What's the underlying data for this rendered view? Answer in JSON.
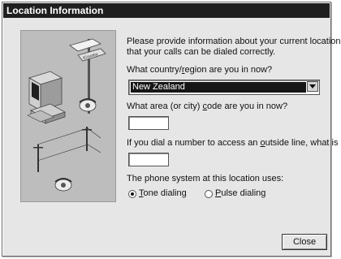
{
  "window": {
    "title": "Location Information"
  },
  "illustration": {
    "signpost_text": "ICountry"
  },
  "intro": {
    "line1": "Please provide information about your current location so",
    "line2": "that your calls can be dialed correctly."
  },
  "country": {
    "label_pre": "What country/",
    "label_u": "r",
    "label_post": "egion are you in now?",
    "value": "New Zealand"
  },
  "area": {
    "label_pre": "What area (or city) ",
    "label_u": "c",
    "label_post": "ode are you in now?",
    "value": ""
  },
  "outside": {
    "label_pre": "If you dial a number to access an ",
    "label_u": "o",
    "label_post": "utside line, what is it?",
    "value": ""
  },
  "phone_system": {
    "label": "The phone system at this location uses:",
    "tone": {
      "u": "T",
      "rest": "one dialing",
      "selected": true
    },
    "pulse": {
      "u": "P",
      "rest": "ulse dialing",
      "selected": false
    }
  },
  "buttons": {
    "close": "Close"
  }
}
